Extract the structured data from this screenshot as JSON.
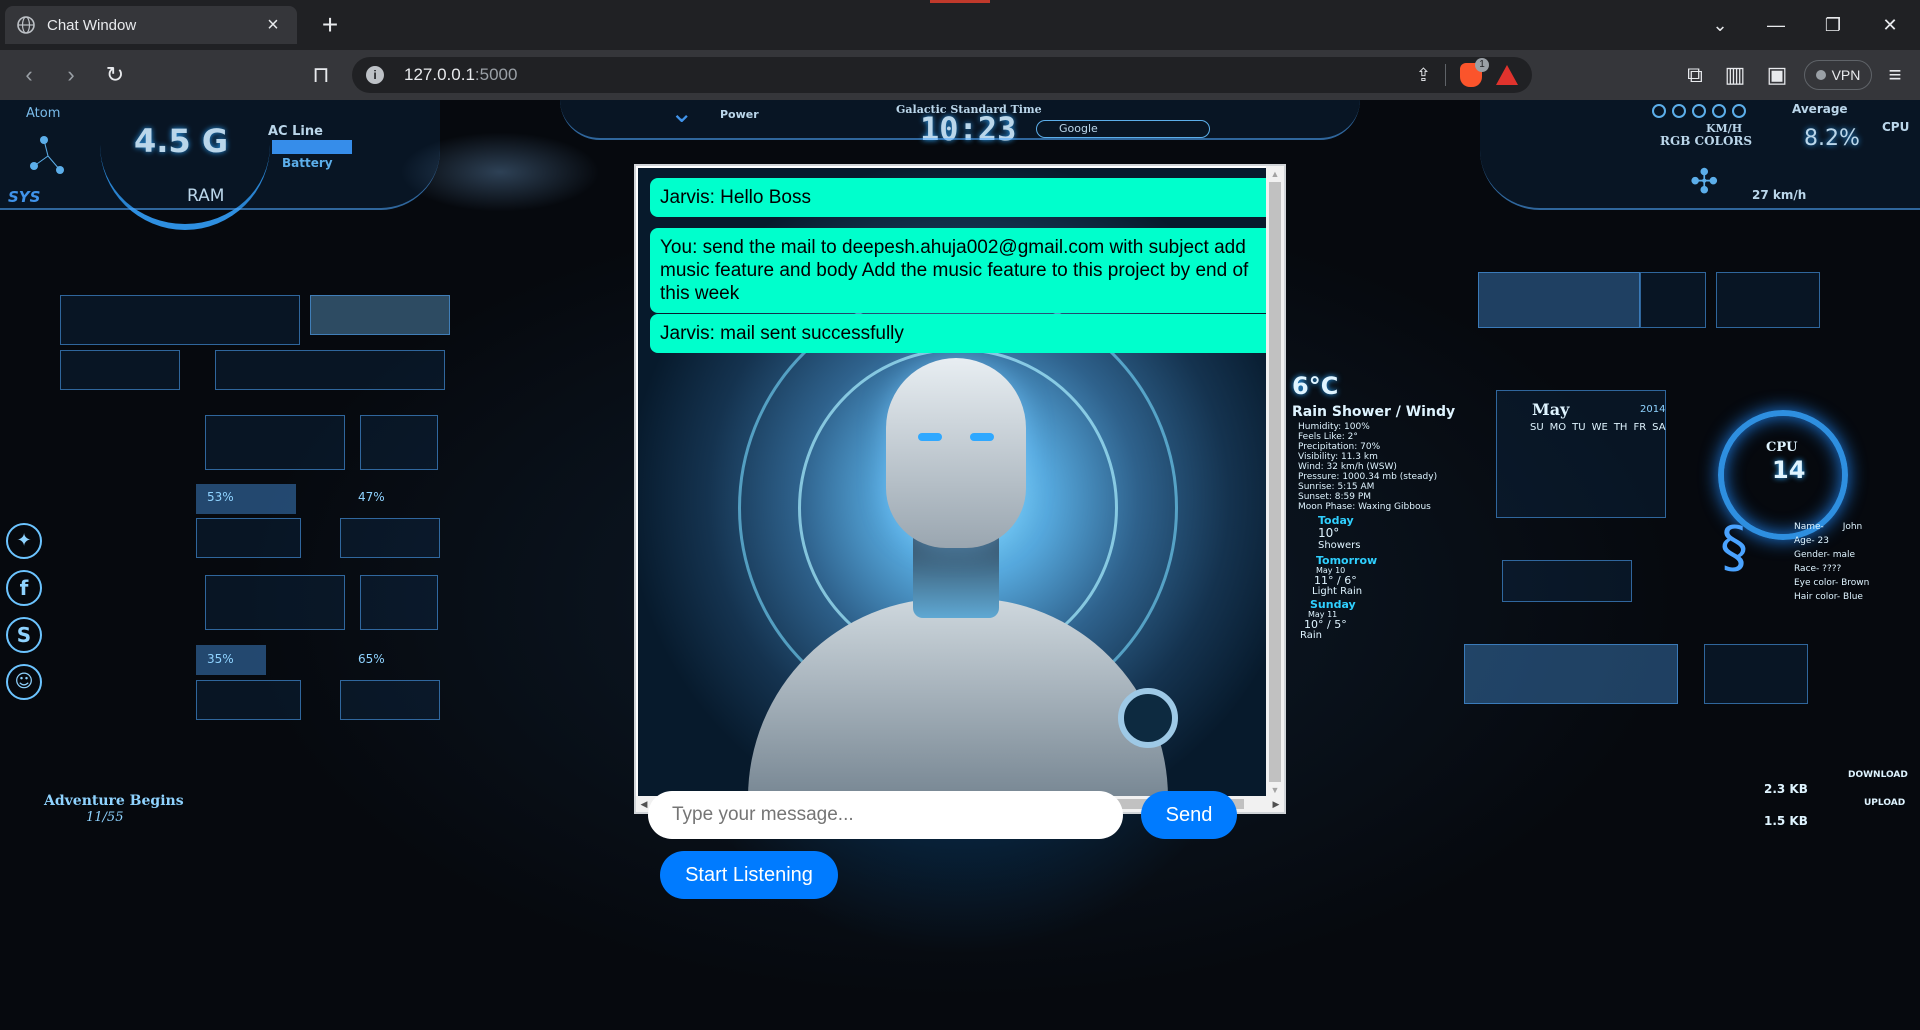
{
  "browser": {
    "tab_title": "Chat Window",
    "url_host": "127.0.0.1",
    "url_port": ":5000",
    "vpn_label": "VPN",
    "shield_badge": "1"
  },
  "hud": {
    "left_top": {
      "atom": "Atom",
      "network": "4.5 G",
      "ram": "RAM",
      "sys": "SYS",
      "ac_line": "AC Line",
      "battery": "Battery"
    },
    "top_center": {
      "power": "Power",
      "time_label": "Galactic Standard Time",
      "time": "10:23",
      "search": "Google"
    },
    "right_top": {
      "average": "Average",
      "cpu": "CPU",
      "rgb": "RGB COLORS",
      "percent": "8.2%",
      "speed": "27 km/h",
      "kmh": "KM/H"
    },
    "weather": {
      "temp": "6°C",
      "condition": "Rain Shower / Windy",
      "details": [
        "Humidity: 100%",
        "Feels Like: 2°",
        "Precipitation: 70%",
        "Visibility: 11.3 km",
        "Wind: 32 km/h (WSW)",
        "Pressure: 1000.34 mb (steady)",
        "Sunrise: 5:15 AM",
        "Sunset: 8:59 PM",
        "Moon Phase: Waxing Gibbous"
      ],
      "today_label": "Today",
      "today_temp": "10°",
      "today_desc": "Showers",
      "tomorrow_label": "Tomorrow",
      "tomorrow_date": "May 10",
      "tomorrow_temp": "11° / 6°",
      "tomorrow_desc": "Light Rain",
      "sunday_label": "Sunday",
      "sunday_date": "May 11",
      "sunday_temp": "10° / 5°",
      "sunday_desc": "Rain"
    },
    "calendar": {
      "month": "May",
      "year": "2014",
      "days": [
        "SU",
        "MO",
        "TU",
        "WE",
        "TH",
        "FR",
        "SA"
      ]
    },
    "cpu_gauge": {
      "label": "CPU",
      "value": "14"
    },
    "profile": [
      "Name-",
      "John",
      "Age- 23",
      "Gender- male",
      "Race- ????",
      "Eye color- Brown",
      "Hair color- Blue"
    ],
    "left_stats": {
      "percent_a": "53%",
      "percent_b": "47%",
      "percent_c": "35%",
      "percent_d": "65%"
    },
    "bottom_left": {
      "title": "Adventure Begins",
      "subtitle": "11/55"
    },
    "bottom_right": {
      "download": "DOWNLOAD",
      "upload": "UPLOAD",
      "kb_a": "2.3 KB",
      "kb_b": "1.5 KB"
    }
  },
  "chat": {
    "messages": [
      {
        "text": "Jarvis: Hello Boss"
      },
      {
        "text": "You: send the mail to deepesh.ahuja002@gmail.com with subject add music feature and body Add the music feature to this project by end of this week"
      },
      {
        "text": "Jarvis: mail sent successfully"
      }
    ],
    "input_placeholder": "Type your message...",
    "send_label": "Send",
    "listen_label": "Start Listening"
  },
  "colors": {
    "bubble": "#00ffcc",
    "button": "#007bff",
    "hud": "#8fd3ff"
  }
}
